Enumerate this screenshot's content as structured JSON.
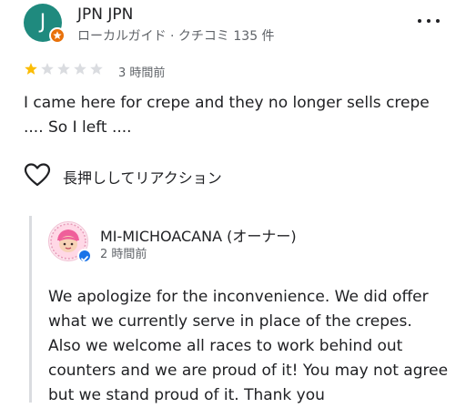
{
  "review": {
    "author_initial": "J",
    "author_name": "JPN JPN",
    "author_meta": "ローカルガイド · クチコミ 135 件",
    "rating": 1,
    "rating_max": 5,
    "time": "3 時間前",
    "text": "I came here for crepe and they no longer sells crepe .... So I left ....",
    "react_label": "長押ししてリアクション"
  },
  "owner_response": {
    "name": "MI-MICHOACANA (オーナー)",
    "time": "2 時間前",
    "text": "We apologize for the inconvenience. We did offer what we currently serve in place of the crepes. Also we welcome all races to work behind out counters and we are proud of it! You may not agree but we stand proud of it. Thank you"
  },
  "colors": {
    "avatar": "#1f8a7e",
    "local_guide_badge": "#e8710a",
    "star_filled": "#fbbc04",
    "star_empty": "#dadce0",
    "verified": "#1a73e8"
  },
  "icons": {
    "more": "more-vert-icon",
    "react": "heart-outline-icon",
    "verified": "verified-check-icon",
    "guide": "local-guide-star-icon"
  }
}
